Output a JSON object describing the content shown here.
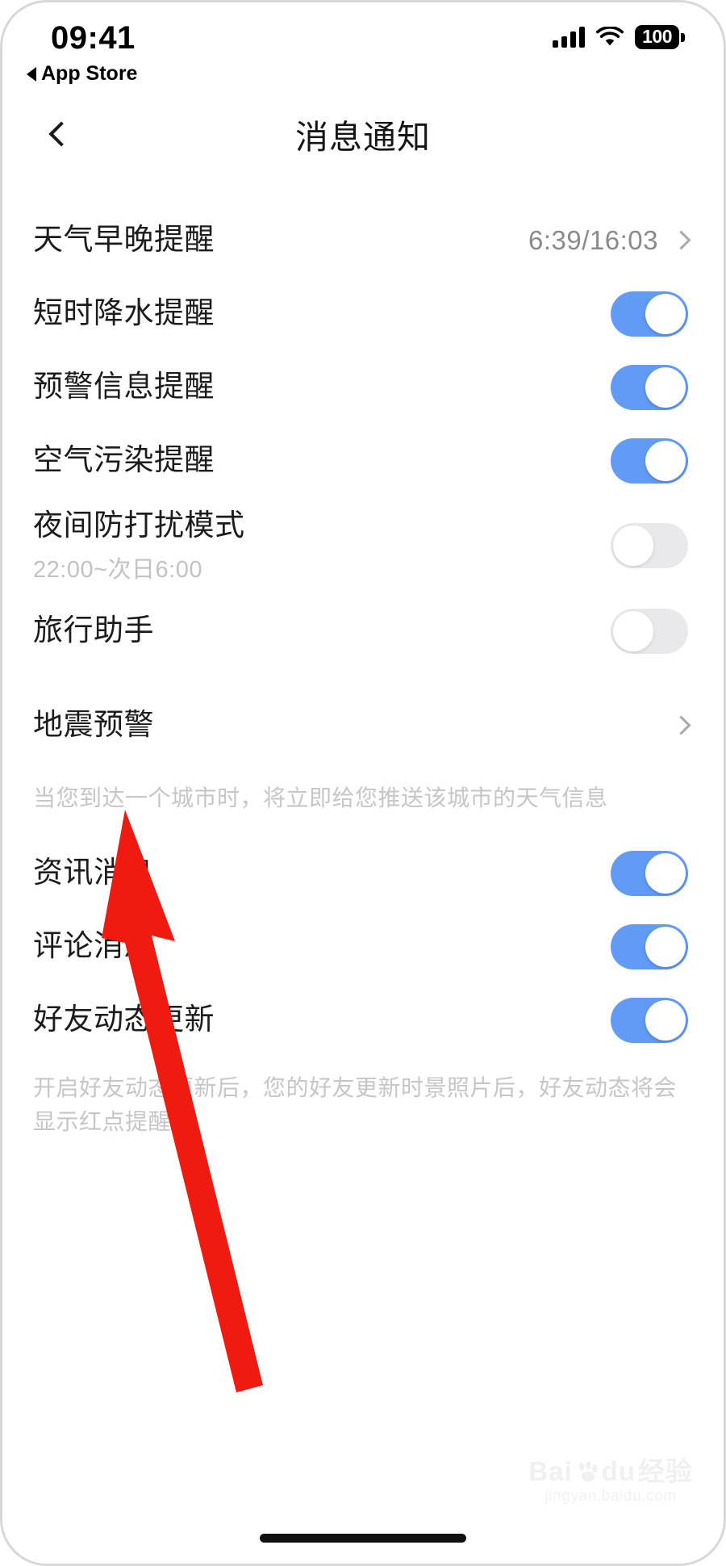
{
  "status_bar": {
    "time": "09:41",
    "back_app": "App Store",
    "battery_level": "100",
    "icons": {
      "signal": "cellular-signal-icon",
      "wifi": "wifi-icon",
      "battery": "battery-icon"
    }
  },
  "nav": {
    "title": "消息通知",
    "back_icon": "chevron-left-icon"
  },
  "settings": {
    "rows": [
      {
        "label": "天气早晚提醒",
        "sub": "",
        "control": "value-chevron",
        "value": "6:39/16:03",
        "state": ""
      },
      {
        "label": "短时降水提醒",
        "sub": "",
        "control": "toggle",
        "value": "",
        "state": "on"
      },
      {
        "label": "预警信息提醒",
        "sub": "",
        "control": "toggle",
        "value": "",
        "state": "on"
      },
      {
        "label": "空气污染提醒",
        "sub": "",
        "control": "toggle",
        "value": "",
        "state": "on"
      },
      {
        "label": "夜间防打扰模式",
        "sub": "22:00~次日6:00",
        "control": "toggle",
        "value": "",
        "state": "off"
      },
      {
        "label": "旅行助手",
        "sub": "",
        "control": "toggle",
        "value": "",
        "state": "off"
      },
      {
        "label": "地震预警",
        "sub": "",
        "control": "chevron",
        "value": "",
        "state": ""
      }
    ],
    "hint_travel": "当您到达一个城市时，将立即给您推送该城市的天气信息",
    "rows2": [
      {
        "label": "资讯消息",
        "sub": "",
        "control": "toggle",
        "value": "",
        "state": "on"
      },
      {
        "label": "评论消息",
        "sub": "",
        "control": "toggle",
        "value": "",
        "state": "on"
      },
      {
        "label": "好友动态更新",
        "sub": "",
        "control": "toggle",
        "value": "",
        "state": "on"
      }
    ],
    "hint_friends": "开启好友动态更新后，您的好友更新时景照片后，好友动态将会显示红点提醒"
  },
  "annotation": {
    "arrow_color": "#f01b10",
    "arrow_name": "red-pointer-arrow"
  },
  "watermark": {
    "brand_left": "Bai",
    "brand_right": "du",
    "brand_cn": "经验",
    "url": "jingyan.baidu.com"
  },
  "colors": {
    "toggle_on": "#629bf6",
    "toggle_off": "#e9e9eb",
    "label": "#1c1c1c",
    "muted": "#c6c6c8",
    "value": "#8a8a8e"
  }
}
